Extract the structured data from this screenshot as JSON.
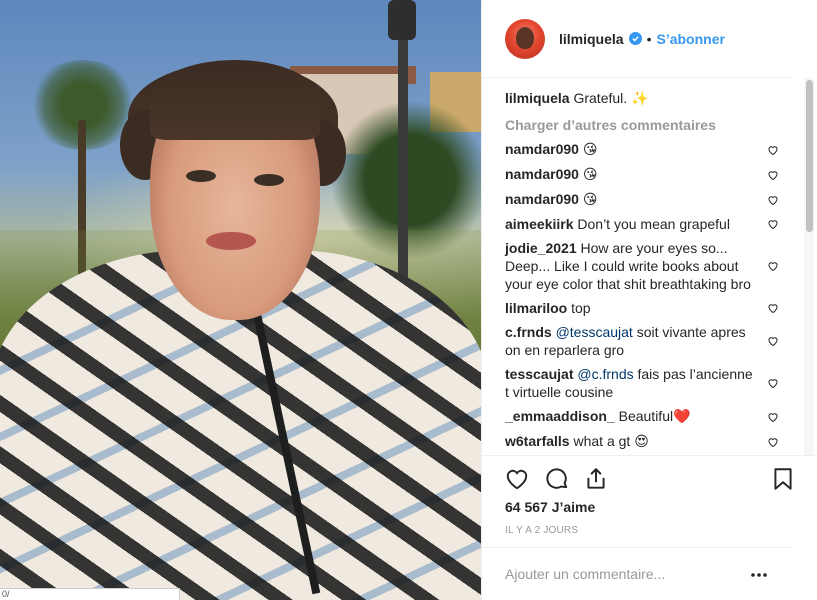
{
  "post": {
    "photo_alt": "selfie photo"
  },
  "header": {
    "username": "lilmiquela",
    "separator": "•",
    "follow_label": "S’abonner"
  },
  "caption": {
    "username": "lilmiquela",
    "text": "Grateful.",
    "emoji": "✨"
  },
  "load_more": "Charger d’autres commentaires",
  "comments": [
    {
      "user": "namdar090",
      "text": "",
      "emoji": "😘"
    },
    {
      "user": "namdar090",
      "text": "",
      "emoji": "😘"
    },
    {
      "user": "namdar090",
      "text": "",
      "emoji": "😘"
    },
    {
      "user": "aimeekiirk",
      "text": "Don’t you mean grapeful",
      "emoji": ""
    },
    {
      "user": "jodie_2021",
      "text": "How are your eyes so... Deep... Like I could write books about your eye color that shit breathtaking bro",
      "emoji": ""
    },
    {
      "user": "lilmariloo",
      "text": "top",
      "emoji": ""
    },
    {
      "user": "c.frnds",
      "mention": "@tesscaujat",
      "text": "soit vivante apres on en reparlera gro",
      "emoji": ""
    },
    {
      "user": "tesscaujat",
      "mention": "@c.frnds",
      "text": "fais pas l’ancienne t virtuelle cousine",
      "emoji": ""
    },
    {
      "user": "_emmaaddison_",
      "text": "Beautiful",
      "emoji": "❤️"
    },
    {
      "user": "w6tarfalls",
      "text": "what a gt",
      "emoji": "😍"
    }
  ],
  "likes": "64 567 J’aime",
  "time": "IL Y A 2 JOURS",
  "add_comment": {
    "placeholder": "Ajouter un commentaire..."
  },
  "photo_corner_text": "0/",
  "colors": {
    "link": "#3897f0",
    "mention": "#003569",
    "muted": "#999999",
    "heart_red": "#ed4956"
  },
  "icons": {
    "like": "heart-outline-icon",
    "comment": "comment-bubble-icon",
    "share": "share-icon",
    "save": "bookmark-icon",
    "comment_like": "small-heart-icon",
    "more": "more-dots-icon",
    "verified": "verified-badge-icon"
  }
}
